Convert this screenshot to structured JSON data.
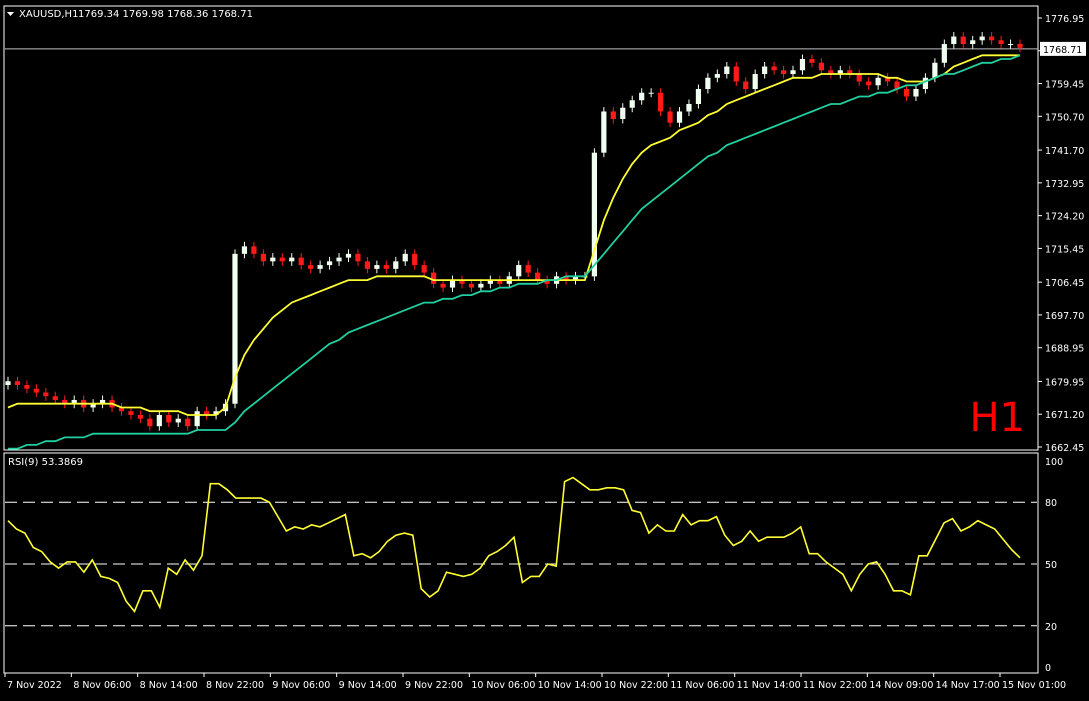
{
  "header": {
    "symbol": "XAUUSD,H1",
    "ohlc": "1769.34 1769.98 1768.36 1768.71",
    "dropdown_icon": "triangle-down-icon"
  },
  "timeframe_label": "H1",
  "price_axis": {
    "ticks": [
      "1776.95",
      "1768.20",
      "1759.45",
      "1750.70",
      "1741.70",
      "1732.95",
      "1724.20",
      "1715.45",
      "1706.45",
      "1697.70",
      "1688.95",
      "1679.95",
      "1671.20",
      "1662.45"
    ],
    "current_price_label": "1768.71"
  },
  "rsi": {
    "label": "RSI(9) 53.3869",
    "ticks": [
      "100",
      "80",
      "50",
      "20",
      "0"
    ]
  },
  "time_axis": {
    "labels": [
      "7 Nov 2022",
      "8 Nov 06:00",
      "8 Nov 14:00",
      "8 Nov 22:00",
      "9 Nov 06:00",
      "9 Nov 14:00",
      "9 Nov 22:00",
      "10 Nov 06:00",
      "10 Nov 14:00",
      "10 Nov 22:00",
      "11 Nov 06:00",
      "11 Nov 14:00",
      "11 Nov 22:00",
      "14 Nov 09:00",
      "14 Nov 17:00",
      "15 Nov 01:00"
    ]
  },
  "colors": {
    "background": "#000000",
    "grid": "#ffffff",
    "bull": "#f0fff0",
    "bear": "#ff1a1a",
    "ma_fast": "#ffff33",
    "ma_slow": "#20d0a0",
    "rsi_line": "#ffff33",
    "timeframe": "#ff0000"
  },
  "chart_data": [
    {
      "type": "candlestick",
      "title": "XAUUSD,H1",
      "ylim": [
        1662.45,
        1776.95
      ],
      "closes": [
        1680,
        1679,
        1678,
        1677,
        1676,
        1675,
        1674,
        1675,
        1673,
        1674,
        1675,
        1673,
        1672,
        1671,
        1670,
        1668,
        1671,
        1669,
        1670,
        1668,
        1672,
        1671,
        1672,
        1674,
        1714,
        1716,
        1714,
        1712,
        1713,
        1712,
        1713,
        1711,
        1710,
        1711,
        1712,
        1713,
        1714,
        1712,
        1710,
        1711,
        1710,
        1712,
        1714,
        1711,
        1709,
        1706,
        1705,
        1707,
        1706,
        1705,
        1706,
        1707,
        1706,
        1708,
        1711,
        1709,
        1707,
        1706,
        1708,
        1707,
        1708,
        1708,
        1741,
        1752,
        1750,
        1753,
        1755,
        1757,
        1757,
        1752,
        1749,
        1752,
        1754,
        1758,
        1761,
        1762,
        1764,
        1760,
        1758,
        1762,
        1764,
        1763,
        1762,
        1763,
        1766,
        1765,
        1763,
        1762,
        1763,
        1762,
        1760,
        1759,
        1761,
        1760,
        1758,
        1756,
        1758,
        1761,
        1765,
        1770,
        1772,
        1770,
        1771,
        1772,
        1771,
        1770,
        1770,
        1769
      ],
      "series": [
        {
          "name": "MA fast",
          "values": [
            1673,
            1674,
            1674,
            1674,
            1674,
            1674,
            1674,
            1674,
            1674,
            1674,
            1674,
            1674,
            1673,
            1673,
            1673,
            1672,
            1672,
            1672,
            1672,
            1671,
            1671,
            1671,
            1671,
            1673,
            1681,
            1687,
            1691,
            1694,
            1697,
            1699,
            1701,
            1702,
            1703,
            1704,
            1705,
            1706,
            1707,
            1707,
            1707,
            1708,
            1708,
            1708,
            1708,
            1708,
            1708,
            1707,
            1707,
            1707,
            1707,
            1707,
            1707,
            1707,
            1707,
            1707,
            1707,
            1707,
            1707,
            1707,
            1707,
            1707,
            1707,
            1707,
            1715,
            1723,
            1729,
            1734,
            1738,
            1741,
            1743,
            1744,
            1745,
            1747,
            1748,
            1749,
            1751,
            1752,
            1754,
            1755,
            1756,
            1757,
            1758,
            1759,
            1760,
            1761,
            1761,
            1761,
            1762,
            1762,
            1762,
            1762,
            1762,
            1762,
            1762,
            1761,
            1761,
            1760,
            1760,
            1760,
            1761,
            1762,
            1764,
            1765,
            1766,
            1767,
            1767,
            1767,
            1767,
            1767
          ]
        },
        {
          "name": "MA slow",
          "values": [
            1662,
            1662,
            1663,
            1663,
            1664,
            1664,
            1665,
            1665,
            1665,
            1666,
            1666,
            1666,
            1666,
            1666,
            1666,
            1666,
            1666,
            1666,
            1666,
            1666,
            1667,
            1667,
            1667,
            1667,
            1669,
            1672,
            1674,
            1676,
            1678,
            1680,
            1682,
            1684,
            1686,
            1688,
            1690,
            1691,
            1693,
            1694,
            1695,
            1696,
            1697,
            1698,
            1699,
            1700,
            1701,
            1701,
            1702,
            1702,
            1703,
            1703,
            1704,
            1704,
            1705,
            1705,
            1706,
            1706,
            1706,
            1707,
            1707,
            1708,
            1708,
            1708,
            1711,
            1714,
            1717,
            1720,
            1723,
            1726,
            1728,
            1730,
            1732,
            1734,
            1736,
            1738,
            1740,
            1741,
            1743,
            1744,
            1745,
            1746,
            1747,
            1748,
            1749,
            1750,
            1751,
            1752,
            1753,
            1754,
            1754,
            1755,
            1756,
            1756,
            1757,
            1757,
            1758,
            1759,
            1759,
            1760,
            1761,
            1762,
            1762,
            1763,
            1764,
            1765,
            1765,
            1766,
            1766,
            1767
          ]
        }
      ]
    },
    {
      "type": "line",
      "title": "RSI(9) 53.3869",
      "ylim": [
        0,
        100
      ],
      "series": [
        {
          "name": "RSI(9)",
          "values": [
            71,
            67,
            65,
            58,
            56,
            51,
            48,
            51,
            51,
            46,
            52,
            44,
            43,
            41,
            32,
            27,
            37,
            37,
            29,
            48,
            45,
            52,
            47,
            54,
            89,
            89,
            86,
            82,
            82,
            82,
            82,
            80,
            73,
            66,
            68,
            67,
            69,
            68,
            70,
            72,
            74,
            54,
            55,
            53,
            56,
            61,
            64,
            65,
            64,
            38,
            34,
            37,
            46,
            45,
            44,
            45,
            48,
            54,
            56,
            59,
            63,
            41,
            44,
            44,
            50,
            49,
            90,
            92,
            89,
            86,
            86,
            87,
            87,
            86,
            76,
            75,
            65,
            69,
            66,
            66,
            74,
            69,
            71,
            71,
            73,
            64,
            59,
            61,
            66,
            61,
            63,
            63,
            63,
            65,
            68,
            55,
            55,
            51,
            48,
            45,
            37,
            45,
            50,
            51,
            45,
            37,
            37,
            35,
            54,
            54,
            62,
            70,
            72,
            66,
            68,
            71,
            69,
            67,
            62,
            57,
            53
          ]
        }
      ]
    }
  ]
}
